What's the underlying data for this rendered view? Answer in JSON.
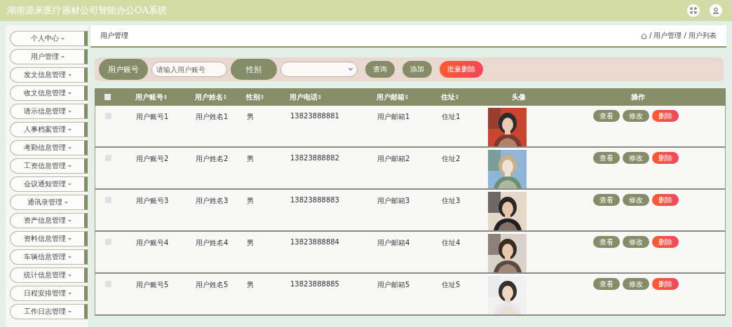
{
  "header": {
    "title": "湖南源来医疗器材公司智能办公OA系统"
  },
  "sidebar": {
    "items": [
      {
        "label": "个人中心"
      },
      {
        "label": "用户管理"
      },
      {
        "label": "发文信息管理"
      },
      {
        "label": "收文信息管理"
      },
      {
        "label": "请示信息管理"
      },
      {
        "label": "人事档案管理"
      },
      {
        "label": "考勤信息管理"
      },
      {
        "label": "工资信息管理"
      },
      {
        "label": "会议通知管理"
      },
      {
        "label": "通讯录管理"
      },
      {
        "label": "资产信息管理"
      },
      {
        "label": "资料信息管理"
      },
      {
        "label": "车辆信息管理"
      },
      {
        "label": "统计信息管理"
      },
      {
        "label": "日程安排管理"
      },
      {
        "label": "工作日志管理"
      }
    ]
  },
  "page_title": "用户管理",
  "breadcrumb": [
    "/ 用户管理",
    "/ 用户列表"
  ],
  "search": {
    "account_label": "用户账号",
    "account_placeholder": "请输入用户账号",
    "gender_label": "性别",
    "buttons": [
      {
        "label": "查询",
        "kind": "normal"
      },
      {
        "label": "添加",
        "kind": "normal"
      },
      {
        "label": "批量删除",
        "kind": "danger"
      }
    ]
  },
  "table": {
    "select_all_checked": false,
    "columns": [
      {
        "label": "用户账号",
        "sortable": true
      },
      {
        "label": "用户姓名",
        "sortable": true
      },
      {
        "label": "性别",
        "sortable": true
      },
      {
        "label": "用户电话",
        "sortable": true
      },
      {
        "label": "用户邮箱",
        "sortable": true
      },
      {
        "label": "住址",
        "sortable": true
      },
      {
        "label": "头像",
        "sortable": false
      },
      {
        "label": "操作",
        "sortable": false
      }
    ],
    "rows": [
      {
        "checked": false,
        "cells": [
          "用户账号1",
          "用户姓名1",
          "男",
          "13823888881",
          "用户邮箱1",
          "住址1"
        ],
        "actions": [
          {
            "label": "查看",
            "kind": "normal"
          },
          {
            "label": "修改",
            "kind": "normal"
          },
          {
            "label": "删除",
            "kind": "danger"
          }
        ]
      },
      {
        "checked": false,
        "cells": [
          "用户账号2",
          "用户姓名2",
          "男",
          "13823888882",
          "用户邮箱2",
          "住址2"
        ],
        "actions": [
          {
            "label": "查看",
            "kind": "normal"
          },
          {
            "label": "修改",
            "kind": "normal"
          },
          {
            "label": "删除",
            "kind": "danger"
          }
        ]
      },
      {
        "checked": false,
        "cells": [
          "用户账号3",
          "用户姓名3",
          "男",
          "13823888883",
          "用户邮箱3",
          "住址3"
        ],
        "actions": [
          {
            "label": "查看",
            "kind": "normal"
          },
          {
            "label": "修改",
            "kind": "normal"
          },
          {
            "label": "删除",
            "kind": "danger"
          }
        ]
      },
      {
        "checked": false,
        "cells": [
          "用户账号4",
          "用户姓名4",
          "男",
          "13823888884",
          "用户邮箱4",
          "住址4"
        ],
        "actions": [
          {
            "label": "查看",
            "kind": "normal"
          },
          {
            "label": "修改",
            "kind": "normal"
          },
          {
            "label": "删除",
            "kind": "danger"
          }
        ]
      },
      {
        "checked": false,
        "cells": [
          "用户账号5",
          "用户姓名5",
          "男",
          "13823888885",
          "用户邮箱5",
          "住址5"
        ],
        "actions": [
          {
            "label": "查看",
            "kind": "normal"
          },
          {
            "label": "修改",
            "kind": "normal"
          },
          {
            "label": "删除",
            "kind": "danger"
          }
        ]
      }
    ]
  }
}
